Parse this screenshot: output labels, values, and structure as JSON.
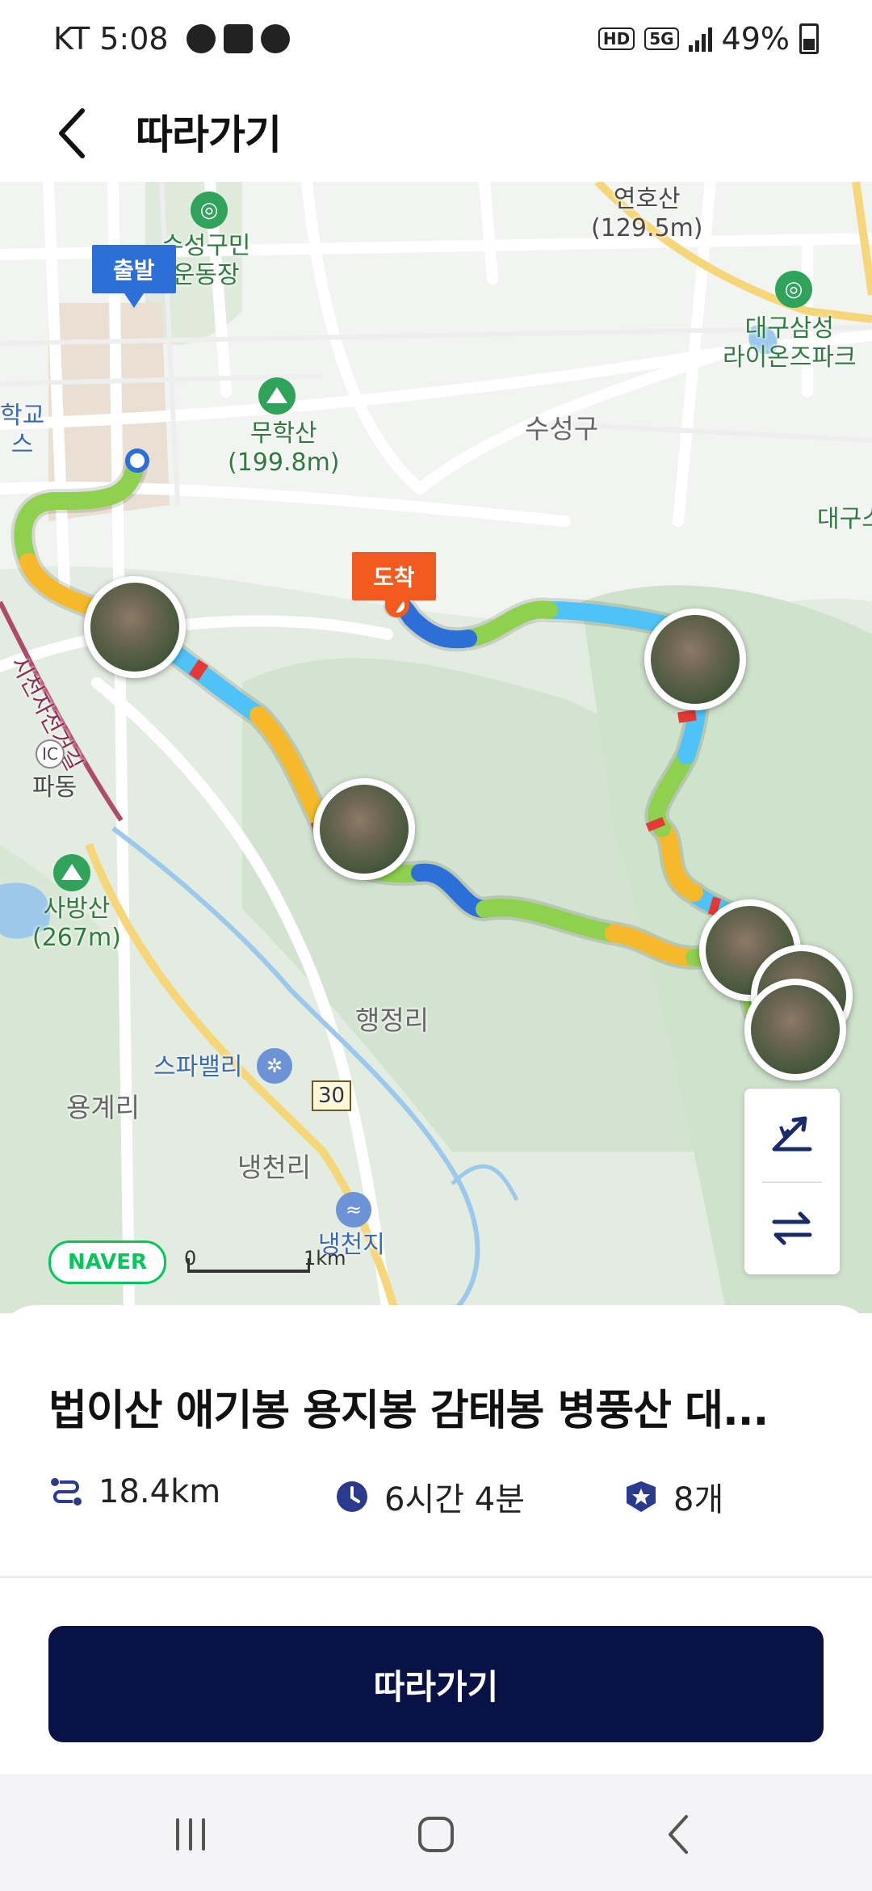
{
  "status_bar": {
    "carrier_time": "KT 5:08",
    "icons": [
      "talk-icon",
      "gallery-icon",
      "cloud-chat-icon"
    ],
    "network": "5G",
    "hd": "HD",
    "battery": "49%"
  },
  "header": {
    "title": "따라가기",
    "back_icon": "chevron-left-icon"
  },
  "map": {
    "places": {
      "suseong_stadium": "수성구민\n운동장",
      "yeonhosan": "연호산\n(129.5m)",
      "daegu_park": "대구삼성\n라이온즈파크",
      "school": "학교\n스",
      "muhaksan": "무학산\n(199.8m)",
      "suseonggu": "수성구",
      "daegu_right": "대구스",
      "road_name": "시천자전거길",
      "ic": "IC",
      "padong": "파동",
      "sabangsan": "사방산\n(267m)",
      "haengjeongri": "행정리",
      "spa_valley": "스파밸리",
      "yonggyeri": "용계리",
      "route_no": "30",
      "naengcheonri": "냉천리",
      "naengcheonji": "냉천지"
    },
    "start_label": "출발",
    "end_label": "도착",
    "naver_logo": "NAVER",
    "scale_zero": "0",
    "scale_km": "1km",
    "photo_count": 6
  },
  "route": {
    "title": "법이산 애기봉 용지봉 감태봉 병풍산 대...",
    "distance": "18.4km",
    "duration": "6시간 4분",
    "stamps": "8개"
  },
  "actions": {
    "follow_label": "따라가기"
  },
  "colors": {
    "primary_button": "#081245",
    "start_flag": "#2d6fd8",
    "end_flag": "#f25a1e"
  }
}
